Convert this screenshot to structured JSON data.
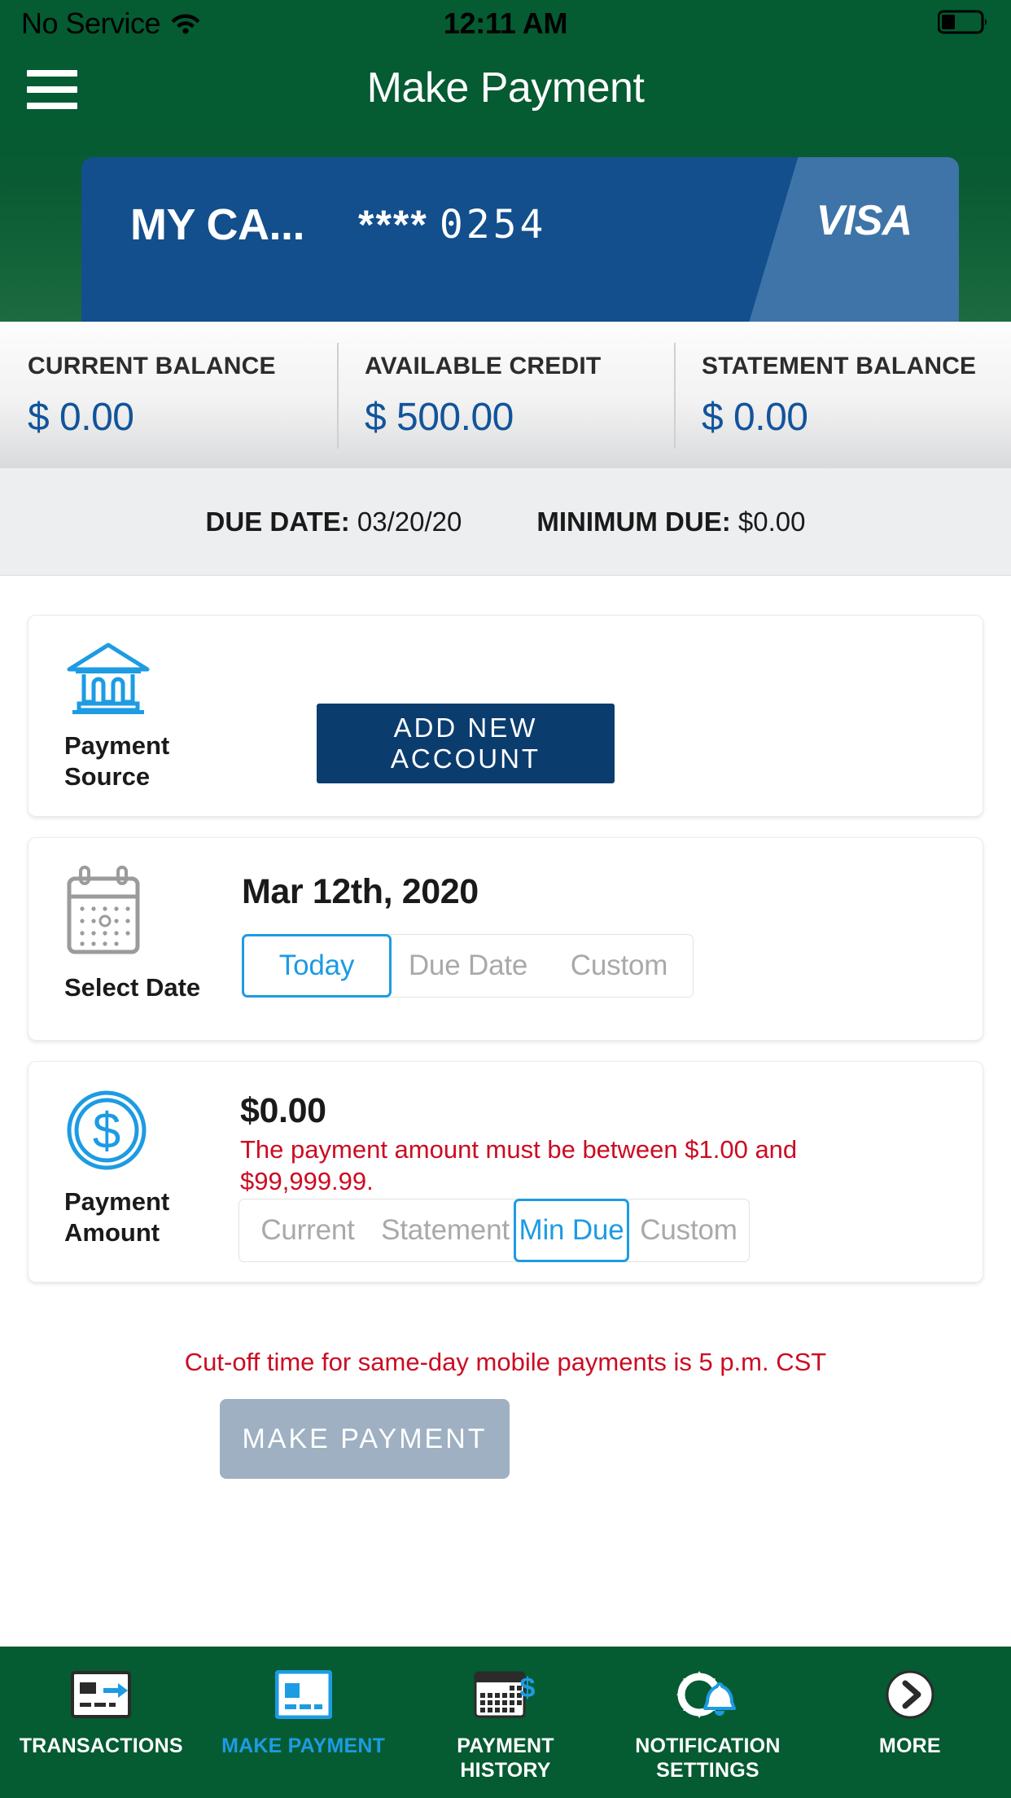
{
  "status_bar": {
    "carrier": "No Service",
    "wifi_icon": "wifi-icon",
    "time": "12:11 AM",
    "battery_icon": "battery-icon"
  },
  "nav": {
    "menu_icon": "hamburger-menu-icon",
    "title": "Make Payment"
  },
  "card": {
    "nickname": "MY CA...",
    "mask": "****",
    "last4": "0254",
    "network": "VISA",
    "card_color": "#124F8C"
  },
  "balances": [
    {
      "label": "CURRENT BALANCE",
      "value": "$ 0.00"
    },
    {
      "label": "AVAILABLE CREDIT",
      "value": "$ 500.00"
    },
    {
      "label": "STATEMENT BALANCE",
      "value": "$ 0.00"
    }
  ],
  "due_row": {
    "due_date_label": "DUE DATE:",
    "due_date_value": "03/20/20",
    "minimum_due_label": "MINIMUM DUE:",
    "minimum_due_value": "$0.00"
  },
  "payment_source": {
    "icon": "bank-icon",
    "caption": "Payment\nSource",
    "caption_line1": "Payment",
    "caption_line2": "Source",
    "add_account_label": "ADD NEW ACCOUNT"
  },
  "select_date": {
    "icon": "calendar-icon",
    "caption": "Select Date",
    "date_value": "Mar 12th, 2020",
    "options": [
      {
        "label": "Today",
        "selected": true
      },
      {
        "label": "Due Date",
        "selected": false
      },
      {
        "label": "Custom",
        "selected": false
      }
    ]
  },
  "payment_amount": {
    "icon": "dollar-coin-icon",
    "caption_line1": "Payment",
    "caption_line2": "Amount",
    "amount_value": "$0.00",
    "error_message": "The payment amount must be between $1.00 and $99,999.99.",
    "options": [
      {
        "label": "Current",
        "selected": false
      },
      {
        "label": "Statement",
        "selected": false
      },
      {
        "label": "Min Due",
        "selected": true
      },
      {
        "label": "Custom",
        "selected": false
      }
    ]
  },
  "footer": {
    "cutoff_notice": "Cut-off time for same-day mobile payments is 5 p.m. CST",
    "make_payment_label": "MAKE PAYMENT",
    "make_payment_enabled": false
  },
  "tabs": [
    {
      "label": "TRANSACTIONS",
      "icon": "card-arrow-icon",
      "active": false
    },
    {
      "label": "MAKE PAYMENT",
      "icon": "card-blue-icon",
      "active": true
    },
    {
      "label": "PAYMENT\nHISTORY",
      "icon": "calendar-dollar-icon",
      "active": false,
      "line1": "PAYMENT",
      "line2": "HISTORY"
    },
    {
      "label": "NOTIFICATION\nSETTINGS",
      "icon": "gear-bell-icon",
      "active": false,
      "line1": "NOTIFICATION",
      "line2": "SETTINGS"
    },
    {
      "label": "MORE",
      "icon": "chevron-right-circle-icon",
      "active": false
    }
  ],
  "colors": {
    "brand_green": "#055B32",
    "accent_blue": "#1D9BE3",
    "deep_blue": "#0B3C6E",
    "error_red": "#CC0C22",
    "disabled_gray": "#9EB0C2"
  }
}
